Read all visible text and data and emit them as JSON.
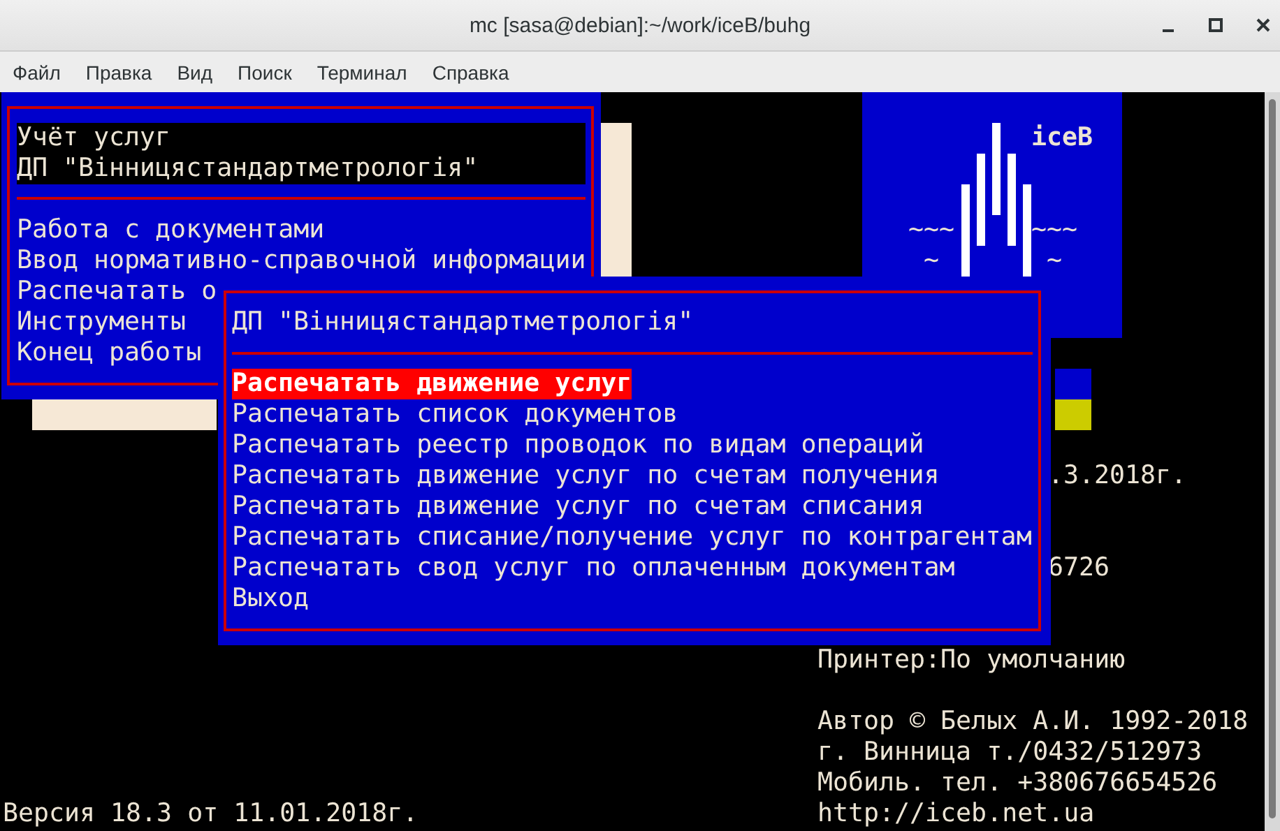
{
  "window": {
    "title": "mc [sasa@debian]:~/work/iceB/buhg"
  },
  "menu_bar": [
    "Файл",
    "Правка",
    "Вид",
    "Поиск",
    "Терминал",
    "Справка"
  ],
  "main_menu": {
    "header": [
      "Учёт услуг",
      "ДП \"Вінницястандартметрологія\""
    ],
    "items": [
      "Работа с документами",
      "Ввод нормативно-справочной информации",
      "Распечатать о",
      "Инструменты",
      "Конец работы"
    ]
  },
  "submenu": {
    "title": "ДП \"Вінницястандартметрологія\"",
    "items": [
      {
        "label": "Распечатать движение услуг",
        "selected": true
      },
      {
        "label": "Распечатать список документов",
        "selected": false
      },
      {
        "label": "Распечатать реестр проводок по видам операций",
        "selected": false
      },
      {
        "label": "Распечатать движение услуг по счетам получения",
        "selected": false
      },
      {
        "label": "Распечатать движение услуг по счетам списания",
        "selected": false
      },
      {
        "label": "Распечатать списание/получение услуг по контрагентам",
        "selected": false
      },
      {
        "label": "Распечатать свод услуг по оплаченным документам",
        "selected": false
      },
      {
        "label": "Выход",
        "selected": false
      }
    ]
  },
  "logo": {
    "name": "iceB",
    "waves": [
      "~~~",
      "~~~"
    ],
    "ripples": [
      "~",
      "~"
    ]
  },
  "info_lines": [
    ".3.2018г.",
    "6726",
    "Принтер:По умолчанию",
    "Автор © Белых А.И. 1992-2018",
    "г. Винница т./0432/512973",
    "Мобиль. тел. +380676654526",
    "http://iceb.net.ua"
  ],
  "version": "Версия 18.3 от 11.01.2018г."
}
